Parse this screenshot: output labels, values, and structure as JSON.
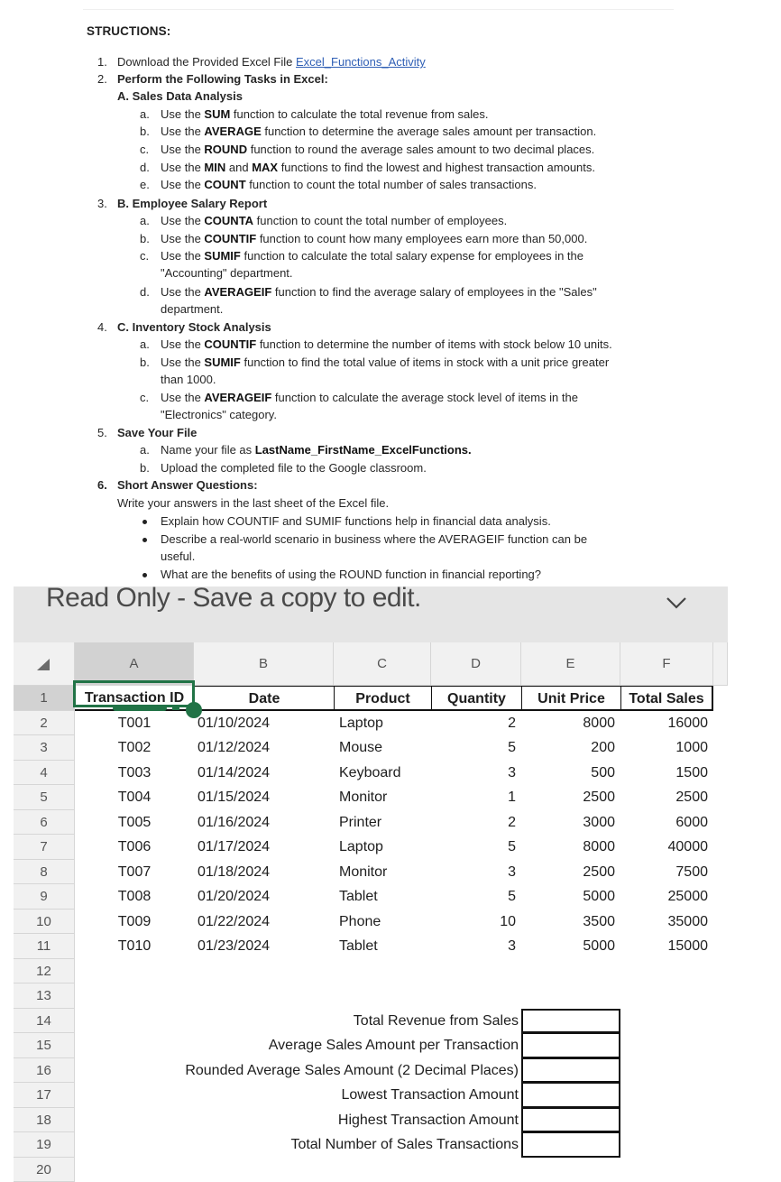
{
  "document": {
    "heading": "STRUCTIONS:",
    "items": [
      {
        "num": "1.",
        "text": "Download the Provided Excel File ",
        "link": "Excel_Functions_Activity"
      },
      {
        "num": "2.",
        "title": "Perform the Following Tasks in Excel:"
      },
      {
        "section": "A. Sales Data Analysis",
        "subitems": [
          {
            "letter": "a.",
            "pre": "Use the ",
            "fn": "SUM",
            "post": " function to calculate the total revenue from sales."
          },
          {
            "letter": "b.",
            "pre": "Use the ",
            "fn": "AVERAGE",
            "post": " function to determine the average sales amount per transaction."
          },
          {
            "letter": "c.",
            "pre": "Use the ",
            "fn": "ROUND",
            "post": " function to round the average sales amount to two decimal places."
          },
          {
            "letter": "d.",
            "pre": "Use the ",
            "fn": "MIN",
            "mid": " and ",
            "fn2": "MAX",
            "post": " functions to find the lowest and highest transaction amounts."
          },
          {
            "letter": "e.",
            "pre": "Use the ",
            "fn": "COUNT",
            "post": " function to count the total number of sales transactions."
          }
        ]
      },
      {
        "num": "3.",
        "title": "B. Employee Salary Report",
        "subitems": [
          {
            "letter": "a.",
            "pre": "Use the ",
            "fn": "COUNTA",
            "post": " function to count the total number of employees."
          },
          {
            "letter": "b.",
            "pre": "Use the ",
            "fn": "COUNTIF",
            "post": " function to count how many employees earn more than 50,000."
          },
          {
            "letter": "c.",
            "pre": "Use the ",
            "fn": "SUMIF",
            "post": " function to calculate the total salary expense for employees in the",
            "cont": "\"Accounting\" department."
          },
          {
            "letter": "d.",
            "pre": "Use the ",
            "fn": "AVERAGEIF",
            "post": " function to find the average salary of employees in the \"Sales\"",
            "cont": "department."
          }
        ]
      },
      {
        "num": "4.",
        "title": "C. Inventory Stock Analysis",
        "subitems": [
          {
            "letter": "a.",
            "pre": "Use the ",
            "fn": "COUNTIF",
            "post": " function to determine the number of items with stock below 10 units."
          },
          {
            "letter": "b.",
            "pre": "Use the ",
            "fn": "SUMIF",
            "post": " function to find the total value of items in stock with a unit price greater",
            "cont": "than 1000."
          },
          {
            "letter": "c.",
            "pre": "Use the ",
            "fn": "AVERAGEIF",
            "post": " function to calculate the average stock level of items in the",
            "cont": "\"Electronics\" category."
          }
        ]
      },
      {
        "num": "5.",
        "title": "Save Your File",
        "subitems": [
          {
            "letter": "a.",
            "pre": "Name your file as ",
            "fn": "LastName_FirstName_ExcelFunctions.",
            "post": ""
          },
          {
            "letter": "b.",
            "pre": "Upload the completed file to the Google classroom.",
            "fn": "",
            "post": ""
          }
        ]
      },
      {
        "num": "6.",
        "title": "Short Answer Questions:",
        "intro": "Write your answers in the last sheet of the Excel file.",
        "bullets": [
          {
            "text": "Explain how COUNTIF and SUMIF functions help in financial data analysis."
          },
          {
            "text": "Describe a real-world scenario in business where the AVERAGEIF function can be",
            "cont": "useful."
          },
          {
            "text": "What are the benefits of using the ROUND function in financial reporting?"
          }
        ]
      }
    ]
  },
  "readonly_bar": {
    "message": "Read Only - Save a copy to edit.",
    "expand_icon": "chevron-down-icon"
  },
  "spreadsheet": {
    "selected_cell": "A1",
    "accent_color": "#217346",
    "column_letters": [
      "A",
      "B",
      "C",
      "D",
      "E",
      "F"
    ],
    "row_numbers": [
      "1",
      "2",
      "3",
      "4",
      "5",
      "6",
      "7",
      "8",
      "9",
      "10",
      "11",
      "12",
      "13",
      "14",
      "15",
      "16",
      "17",
      "18",
      "19",
      "20"
    ],
    "headers": [
      "Transaction ID",
      "Date",
      "Product",
      "Quantity",
      "Unit Price",
      "Total Sales"
    ],
    "rows": [
      [
        "T001",
        "01/10/2024",
        "Laptop",
        "2",
        "8000",
        "16000"
      ],
      [
        "T002",
        "01/12/2024",
        "Mouse",
        "5",
        "200",
        "1000"
      ],
      [
        "T003",
        "01/14/2024",
        "Keyboard",
        "3",
        "500",
        "1500"
      ],
      [
        "T004",
        "01/15/2024",
        "Monitor",
        "1",
        "2500",
        "2500"
      ],
      [
        "T005",
        "01/16/2024",
        "Printer",
        "2",
        "3000",
        "6000"
      ],
      [
        "T006",
        "01/17/2024",
        "Laptop",
        "5",
        "8000",
        "40000"
      ],
      [
        "T007",
        "01/18/2024",
        "Monitor",
        "3",
        "2500",
        "7500"
      ],
      [
        "T008",
        "01/20/2024",
        "Tablet",
        "5",
        "5000",
        "25000"
      ],
      [
        "T009",
        "01/22/2024",
        "Phone",
        "10",
        "3500",
        "35000"
      ],
      [
        "T010",
        "01/23/2024",
        "Tablet",
        "3",
        "5000",
        "15000"
      ]
    ],
    "summary_labels": [
      {
        "label": "Total Revenue from Sales",
        "value": ""
      },
      {
        "label": "Average Sales Amount per Transaction",
        "value": ""
      },
      {
        "label": "Rounded Average Sales Amount (2 Decimal Places)",
        "value": ""
      },
      {
        "label": "Lowest Transaction Amount",
        "value": ""
      },
      {
        "label": "Highest Transaction Amount",
        "value": ""
      },
      {
        "label": "Total Number of Sales Transactions",
        "value": ""
      }
    ]
  }
}
